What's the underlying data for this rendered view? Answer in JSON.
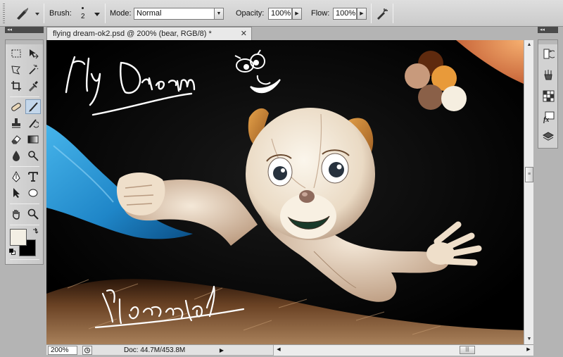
{
  "options_bar": {
    "brush_label": "Brush:",
    "brush_size": "2",
    "mode_label": "Mode:",
    "mode_value": "Normal",
    "opacity_label": "Opacity:",
    "opacity_value": "100%",
    "flow_label": "Flow:",
    "flow_value": "100%"
  },
  "document": {
    "tab_title": "flying dream-ok2.psd @ 200% (bear, RGB/8) *",
    "close_glyph": "✕",
    "zoom": "200%",
    "doc_info": "Doc: 44.7M/453.8M"
  },
  "canvas": {
    "text_top": "Fly Dream",
    "signature": "Abalad",
    "palette_colors": [
      "#5e2a0e",
      "#c89a7c",
      "#e89a3a",
      "#8a6048",
      "#f5eee0"
    ]
  },
  "tools": [
    "marquee-tool",
    "move-tool",
    "lasso-tool",
    "magic-wand-tool",
    "crop-tool",
    "eyedropper-tool",
    "healing-brush-tool",
    "brush-tool",
    "clone-stamp-tool",
    "history-brush-tool",
    "eraser-tool",
    "gradient-tool",
    "blur-tool",
    "dodge-tool",
    "pen-tool",
    "type-tool",
    "path-selection-tool",
    "shape-tool",
    "hand-tool",
    "zoom-tool"
  ],
  "colors": {
    "foreground": "#f3efe4",
    "background": "#000000",
    "active_tool_bg": "#c3d6ea"
  },
  "dock_icons": [
    "history-icon",
    "actions-icon",
    "swatches-icon",
    "styles-fx-icon",
    "layers-icon"
  ]
}
